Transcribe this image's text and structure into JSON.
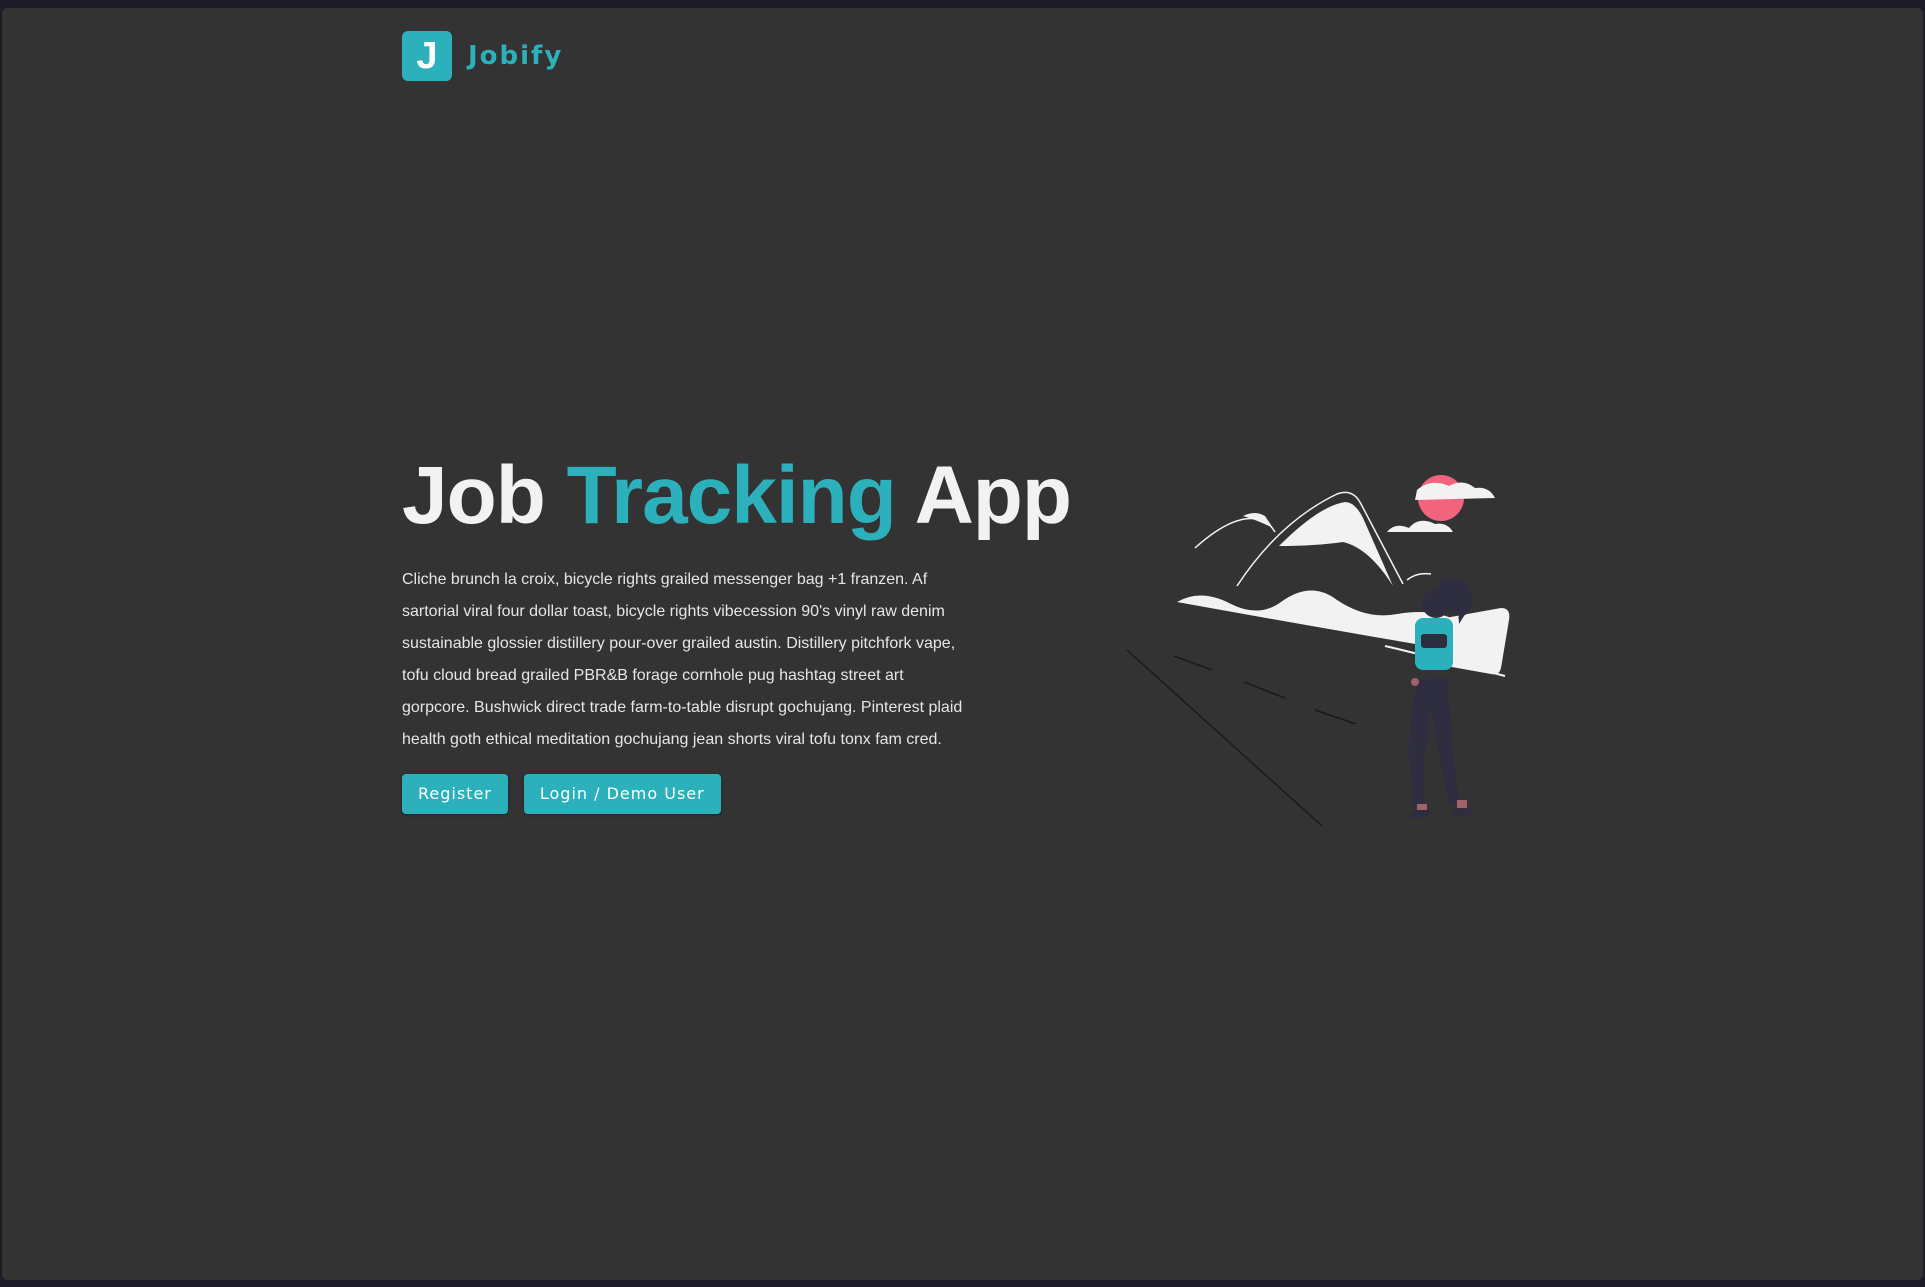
{
  "brand": {
    "logo_letter": "J",
    "name": "Jobify",
    "color": "#2cb1bc"
  },
  "hero": {
    "title_part1": "Job",
    "title_accent": "Tracking",
    "title_part2": "App",
    "description": "Cliche brunch la croix, bicycle rights grailed messenger bag +1 franzen. Af sartorial viral four dollar toast, bicycle rights vibecession 90's vinyl raw denim sustainable glossier distillery pour-over grailed austin. Distillery pitchfork vape, tofu cloud bread grailed PBR&B forage cornhole pug hashtag street art gorpcore. Bushwick direct trade farm-to-table disrupt gochujang. Pinterest plaid health goth ethical meditation gochujang jean shorts viral tofu tonx fam cred."
  },
  "actions": {
    "register_label": "Register",
    "login_label": "Login / Demo User"
  },
  "illustration": {
    "name": "hiker-mountains-illustration",
    "sun_color": "#f2637e",
    "accent_color": "#2cb1bc"
  }
}
